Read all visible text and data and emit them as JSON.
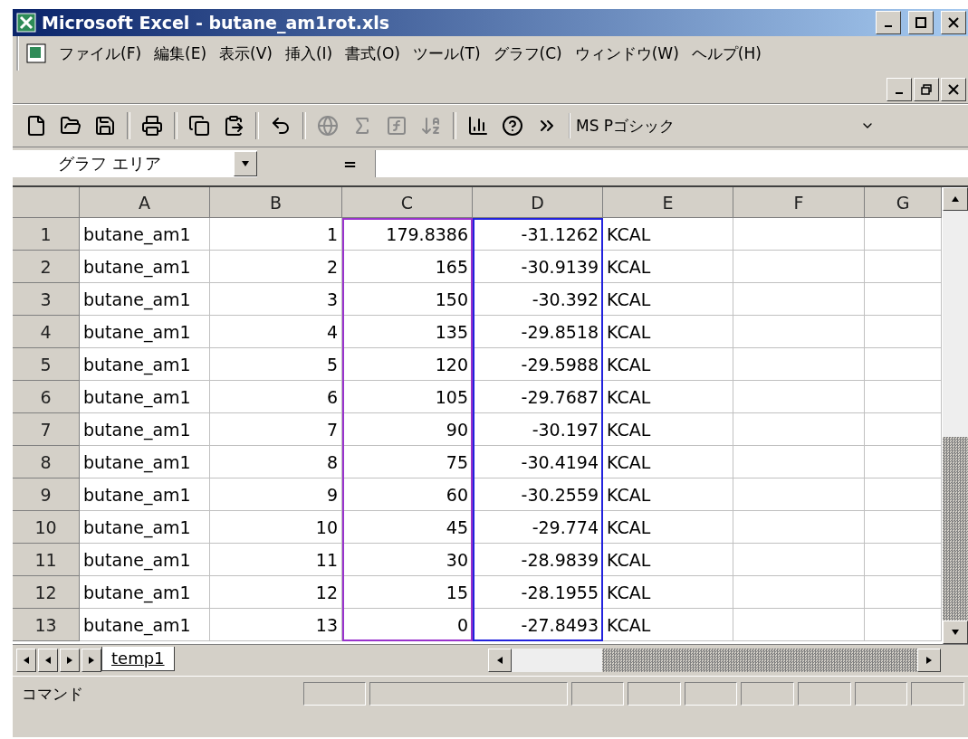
{
  "window": {
    "title": "Microsoft Excel - butane_am1rot.xls"
  },
  "menu": [
    "ファイル(F)",
    "編集(E)",
    "表示(V)",
    "挿入(I)",
    "書式(O)",
    "ツール(T)",
    "グラフ(C)",
    "ウィンドウ(W)",
    "ヘルプ(H)"
  ],
  "toolbar": [
    {
      "kind": "new",
      "disabled": false
    },
    {
      "kind": "open",
      "disabled": false
    },
    {
      "kind": "save",
      "disabled": false
    },
    {
      "kind": "sep"
    },
    {
      "kind": "print",
      "disabled": false
    },
    {
      "kind": "sep"
    },
    {
      "kind": "copy",
      "disabled": false
    },
    {
      "kind": "paste",
      "disabled": false
    },
    {
      "kind": "sep"
    },
    {
      "kind": "undo",
      "disabled": false
    },
    {
      "kind": "sep"
    },
    {
      "kind": "web",
      "disabled": true
    },
    {
      "kind": "sum",
      "disabled": true
    },
    {
      "kind": "function",
      "disabled": true
    },
    {
      "kind": "sort",
      "disabled": true
    },
    {
      "kind": "sep"
    },
    {
      "kind": "chart",
      "disabled": false
    },
    {
      "kind": "help",
      "disabled": false
    },
    {
      "kind": "more",
      "disabled": false
    }
  ],
  "font_box": {
    "value": "MS Pゴシック"
  },
  "name_box": {
    "value": "グラフ エリア"
  },
  "formula_button": "=",
  "table": {
    "columns": [
      {
        "label": "A"
      },
      {
        "label": "B"
      },
      {
        "label": "C",
        "color": "#9933cc"
      },
      {
        "label": "D",
        "color": "#2222dd"
      },
      {
        "label": "E"
      },
      {
        "label": "F"
      },
      {
        "label": "G"
      }
    ],
    "rows": [
      {
        "header": "1",
        "cells": [
          "butane_am1",
          "1",
          "179.8386",
          "-31.1262",
          "KCAL"
        ]
      },
      {
        "header": "2",
        "cells": [
          "butane_am1",
          "2",
          "165",
          "-30.9139",
          "KCAL"
        ]
      },
      {
        "header": "3",
        "cells": [
          "butane_am1",
          "3",
          "150",
          "-30.392",
          "KCAL"
        ]
      },
      {
        "header": "4",
        "cells": [
          "butane_am1",
          "4",
          "135",
          "-29.8518",
          "KCAL"
        ]
      },
      {
        "header": "5",
        "cells": [
          "butane_am1",
          "5",
          "120",
          "-29.5988",
          "KCAL"
        ]
      },
      {
        "header": "6",
        "cells": [
          "butane_am1",
          "6",
          "105",
          "-29.7687",
          "KCAL"
        ]
      },
      {
        "header": "7",
        "cells": [
          "butane_am1",
          "7",
          "90",
          "-30.197",
          "KCAL"
        ]
      },
      {
        "header": "8",
        "cells": [
          "butane_am1",
          "8",
          "75",
          "-30.4194",
          "KCAL"
        ]
      },
      {
        "header": "9",
        "cells": [
          "butane_am1",
          "9",
          "60",
          "-30.2559",
          "KCAL"
        ]
      },
      {
        "header": "10",
        "cells": [
          "butane_am1",
          "10",
          "45",
          "-29.774",
          "KCAL"
        ]
      },
      {
        "header": "11",
        "cells": [
          "butane_am1",
          "11",
          "30",
          "-28.9839",
          "KCAL"
        ]
      },
      {
        "header": "12",
        "cells": [
          "butane_am1",
          "12",
          "15",
          "-28.1955",
          "KCAL"
        ]
      },
      {
        "header": "13",
        "cells": [
          "butane_am1",
          "13",
          "0",
          "-27.8493",
          "KCAL"
        ]
      }
    ]
  },
  "sheet_tabs": [
    {
      "label": "temp1",
      "selected": true
    }
  ],
  "status_bar": {
    "text": "コマンド"
  }
}
